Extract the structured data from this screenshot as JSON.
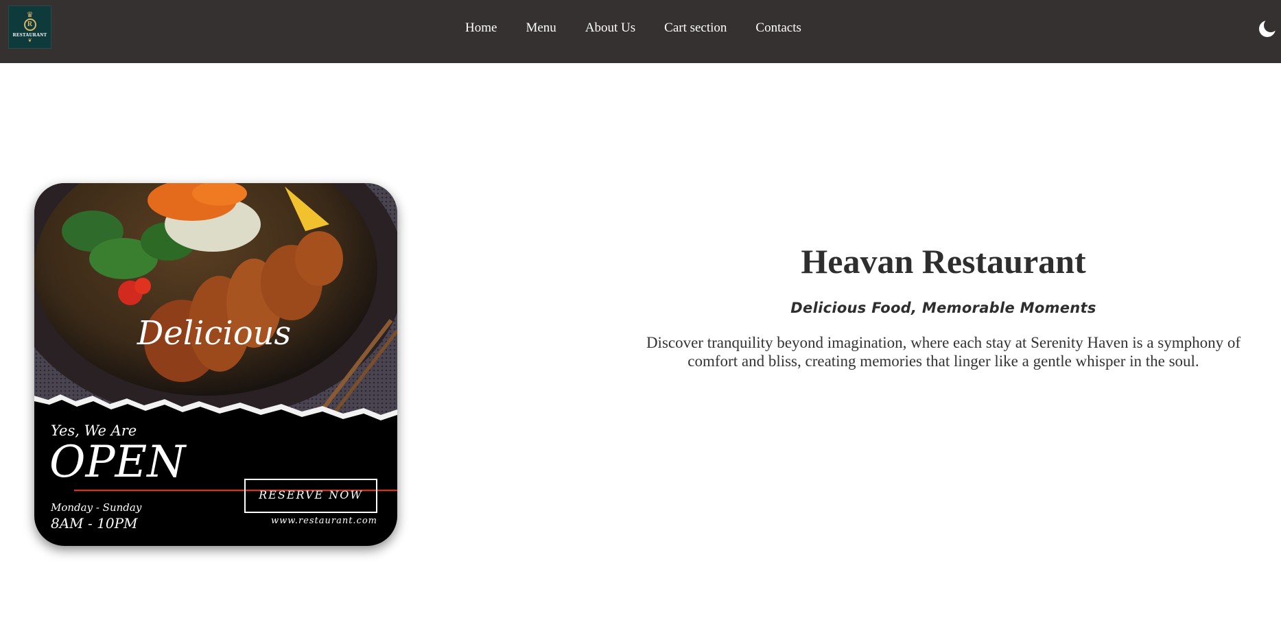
{
  "logo": {
    "initial": "R",
    "text": "RESTAURANT"
  },
  "nav": {
    "items": [
      "Home",
      "Menu",
      "About Us",
      "Cart section",
      "Contacts"
    ]
  },
  "theme_toggle": {
    "icon": "moon-icon"
  },
  "promo_card": {
    "headline": "Delicious",
    "tagline": "Yes, We Are",
    "open_text": "OPEN",
    "days": "Monday - Sunday",
    "hours": "8AM - 10PM",
    "reserve_label": "RESERVE NOW",
    "website": "www.restaurant.com",
    "accent_color": "#c0392b"
  },
  "hero": {
    "title": "Heavan Restaurant",
    "subtitle": "Delicious Food, Memorable Moments",
    "description": "Discover tranquility beyond imagination, where each stay at Serenity Haven is a symphony of comfort and bliss, creating memories that linger like a gentle whisper in the soul."
  }
}
